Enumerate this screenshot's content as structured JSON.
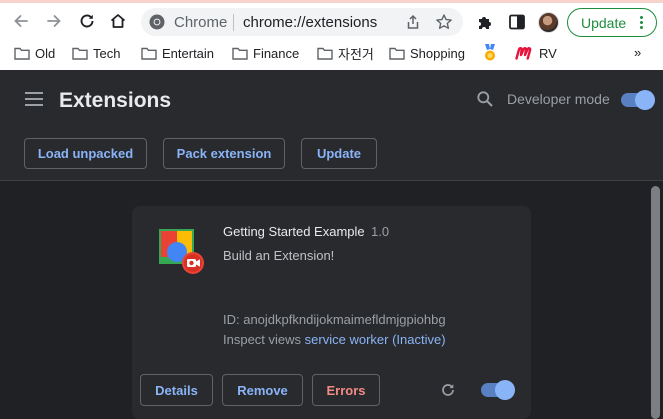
{
  "browser": {
    "omnibox": {
      "site_label": "Chrome",
      "url": "chrome://extensions"
    },
    "update_button": "Update",
    "bookmarks": [
      {
        "label": "Old",
        "icon": "folder-icon"
      },
      {
        "label": "Tech",
        "icon": "folder-icon"
      },
      {
        "label": "Entertain",
        "icon": "folder-icon"
      },
      {
        "label": "Finance",
        "icon": "folder-icon"
      },
      {
        "label": "자전거",
        "icon": "folder-icon"
      },
      {
        "label": "Shopping",
        "icon": "folder-icon"
      },
      {
        "label": "",
        "icon": "medal-icon"
      },
      {
        "label": "RV",
        "icon": "m-logo-icon"
      }
    ],
    "bookmarks_overflow": "»",
    "colors": {
      "update_accent": "#1e8e3e",
      "toolbar_bg": "#ffffff"
    }
  },
  "page": {
    "title": "Extensions",
    "developer_mode_label": "Developer mode",
    "developer_mode_on": true,
    "actions": {
      "load_unpacked": "Load unpacked",
      "pack_extension": "Pack extension",
      "update": "Update"
    },
    "colors": {
      "accent": "#8ab4f8",
      "background": "#202124",
      "surface": "#292a2d",
      "error": "#f28b82"
    }
  },
  "extension": {
    "name": "Getting Started Example",
    "version": "1.0",
    "description": "Build an Extension!",
    "id_label": "ID: anojdkpfkndijokmaimefldmjgpiohbg",
    "inspect_label": "Inspect views",
    "inspect_link": "service worker (Inactive)",
    "enabled": true,
    "buttons": {
      "details": "Details",
      "remove": "Remove",
      "errors": "Errors"
    }
  }
}
